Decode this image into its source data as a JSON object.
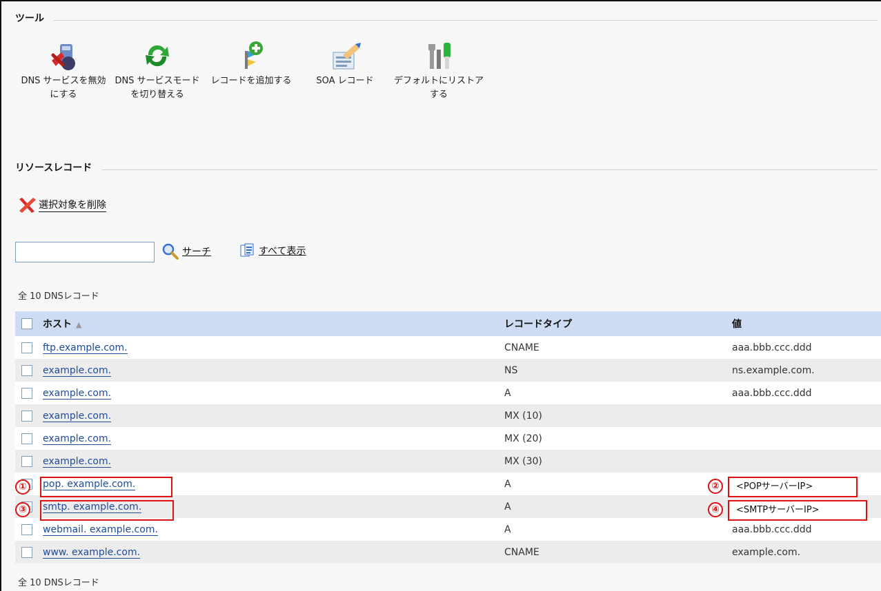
{
  "tools_section": {
    "title": "ツール"
  },
  "toolbar": [
    {
      "label": "DNS サービスを無効にする",
      "icon": "dns-disable-icon"
    },
    {
      "label": "DNS サービスモードを切り替える",
      "icon": "switch-mode-icon"
    },
    {
      "label": "レコードを追加する",
      "icon": "add-record-icon"
    },
    {
      "label": "SOA レコード",
      "icon": "soa-record-icon"
    },
    {
      "label": "デフォルトにリストアする",
      "icon": "restore-default-icon"
    }
  ],
  "records_section": {
    "title": "リソースレコード"
  },
  "actions": {
    "delete_selected": "選択対象を削除"
  },
  "search": {
    "value": "",
    "placeholder": "",
    "search_label": "サーチ",
    "show_all_label": "すべて表示"
  },
  "counts": {
    "top": "全 10 DNSレコード",
    "bottom": "全 10 DNSレコード"
  },
  "table": {
    "headers": {
      "host": "ホスト",
      "sort_indicator": "▲",
      "type": "レコードタイプ",
      "value": "値"
    },
    "rows": [
      {
        "host": "ftp.example.com.",
        "type": "CNAME",
        "value": "aaa.bbb.ccc.ddd"
      },
      {
        "host": "example.com.",
        "type": "NS",
        "value": "ns.example.com."
      },
      {
        "host": "example.com.",
        "type": "A",
        "value": "aaa.bbb.ccc.ddd"
      },
      {
        "host": "example.com.",
        "type": "MX (10)",
        "value": ""
      },
      {
        "host": "example.com.",
        "type": "MX (20)",
        "value": ""
      },
      {
        "host": "example.com.",
        "type": "MX (30)",
        "value": ""
      },
      {
        "host": "pop. example.com.",
        "type": "A",
        "value": ""
      },
      {
        "host": "smtp. example.com.",
        "type": "A",
        "value": ""
      },
      {
        "host": "webmail. example.com.",
        "type": "A",
        "value": "aaa.bbb.ccc.ddd"
      },
      {
        "host": "www. example.com.",
        "type": "CNAME",
        "value": "example.com."
      }
    ]
  },
  "annotations": {
    "markers": [
      "①",
      "②",
      "③",
      "④"
    ],
    "pop_value": "<POPサーバーIP>",
    "smtp_value": "<SMTPサーバーIP>",
    "color": "#e01010"
  }
}
